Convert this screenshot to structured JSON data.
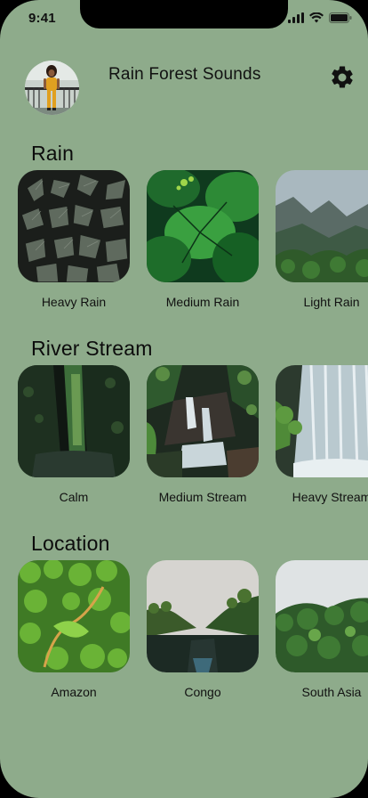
{
  "status_bar": {
    "time": "9:41"
  },
  "header": {
    "title": "Rain Forest Sounds"
  },
  "sections": [
    {
      "title": "Rain",
      "items": [
        {
          "label": "Heavy Rain"
        },
        {
          "label": "Medium Rain"
        },
        {
          "label": "Light Rain"
        }
      ]
    },
    {
      "title": "River Stream",
      "items": [
        {
          "label": "Calm"
        },
        {
          "label": "Medium Stream"
        },
        {
          "label": "Heavy Stream"
        }
      ]
    },
    {
      "title": "Location",
      "items": [
        {
          "label": "Amazon"
        },
        {
          "label": "Congo"
        },
        {
          "label": "South Asia"
        }
      ]
    }
  ],
  "colors": {
    "background": "#8eab8b",
    "text": "#111111"
  }
}
